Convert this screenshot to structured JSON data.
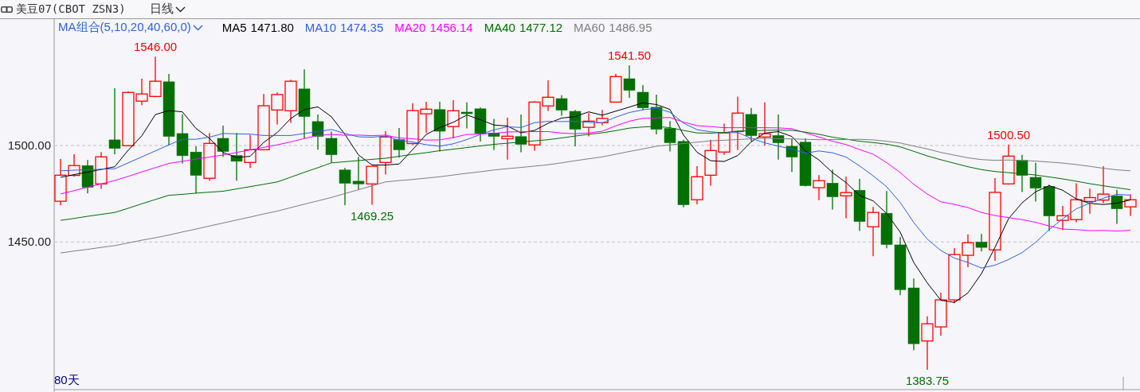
{
  "header": {
    "title": "美豆07(CBOT ZSN3)",
    "period": "日线"
  },
  "chart": {
    "indicator": "MA组合(5,10,20,40,60,0)",
    "legend": [
      {
        "reading": "1471.80"
      },
      {
        "reading": "1474.35"
      },
      {
        "reading": "1456.14"
      },
      {
        "reading": "1477.12"
      },
      {
        "reading": "1486.95"
      }
    ],
    "span_label": "80天",
    "candles": {
      "chart_data": {
        "type": "candlestick",
        "ohlc": [
          [
            1471.1,
            1493.0,
            1469.1,
            1484.6
          ],
          [
            1484.5,
            1495.5,
            1483.8,
            1489.6
          ],
          [
            1489.6,
            1492.5,
            1475.2,
            1478.3
          ],
          [
            1480.1,
            1496.6,
            1477.5,
            1494.1
          ],
          [
            1502.9,
            1529.7,
            1495.5,
            1498.5
          ],
          [
            1499.9,
            1528.0,
            1499.6,
            1527.5
          ],
          [
            1523.0,
            1534.6,
            1520.9,
            1526.7
          ],
          [
            1525.4,
            1546.0,
            1525.0,
            1533.3
          ],
          [
            1533.0,
            1537.1,
            1500.0,
            1504.7
          ],
          [
            1506.2,
            1516.1,
            1490.7,
            1494.7
          ],
          [
            1496.6,
            1499.6,
            1475.2,
            1484.5
          ],
          [
            1483.0,
            1506.5,
            1481.8,
            1501.1
          ],
          [
            1503.7,
            1510.3,
            1494.1,
            1496.9
          ],
          [
            1494.8,
            1506.5,
            1481.8,
            1491.8
          ],
          [
            1491.2,
            1505.4,
            1488.4,
            1497.8
          ],
          [
            1497.8,
            1526.7,
            1497.8,
            1520.6
          ],
          [
            1518.4,
            1527.5,
            1510.9,
            1526.4
          ],
          [
            1518.0,
            1534.1,
            1511.7,
            1533.3
          ],
          [
            1529.3,
            1539.4,
            1503.7,
            1515.0
          ],
          [
            1512.4,
            1516.1,
            1497.8,
            1504.7
          ],
          [
            1503.7,
            1507.2,
            1491.0,
            1495.2
          ],
          [
            1487.3,
            1488.4,
            1469.1,
            1480.4
          ],
          [
            1481.5,
            1494.1,
            1477.0,
            1480.1
          ],
          [
            1480.1,
            1489.2,
            1469.25,
            1489.2
          ],
          [
            1491.2,
            1507.4,
            1484.9,
            1504.4
          ],
          [
            1503.0,
            1509.1,
            1493.7,
            1497.8
          ],
          [
            1501.0,
            1521.9,
            1500.3,
            1518.1
          ],
          [
            1516.4,
            1522.7,
            1506.5,
            1518.8
          ],
          [
            1518.6,
            1522.7,
            1496.9,
            1507.4
          ],
          [
            1509.8,
            1523.5,
            1503.7,
            1518.0
          ],
          [
            1517.3,
            1522.3,
            1508.8,
            1516.8
          ],
          [
            1519.0,
            1519.8,
            1502.1,
            1506.2
          ],
          [
            1506.5,
            1513.8,
            1497.6,
            1504.7
          ],
          [
            1503.5,
            1514.4,
            1492.7,
            1504.8
          ],
          [
            1504.6,
            1516.1,
            1496.5,
            1500.6
          ],
          [
            1500.3,
            1523.0,
            1497.3,
            1522.5
          ],
          [
            1520.5,
            1533.8,
            1517.9,
            1525.0
          ],
          [
            1524.3,
            1526.0,
            1515.4,
            1518.3
          ],
          [
            1517.7,
            1518.4,
            1499.6,
            1508.4
          ],
          [
            1509.4,
            1516.8,
            1504.7,
            1512.6
          ],
          [
            1511.8,
            1518.4,
            1510.5,
            1514.0
          ],
          [
            1522.5,
            1537.1,
            1522.5,
            1535.7
          ],
          [
            1534.6,
            1541.5,
            1524.7,
            1528.6
          ],
          [
            1527.6,
            1531.3,
            1518.4,
            1519.5
          ],
          [
            1519.8,
            1526.4,
            1505.8,
            1508.4
          ],
          [
            1508.8,
            1512.7,
            1496.9,
            1501.4
          ],
          [
            1502.1,
            1503.0,
            1468.0,
            1469.3
          ],
          [
            1471.9,
            1489.3,
            1469.5,
            1483.8
          ],
          [
            1484.6,
            1503.0,
            1479.2,
            1497.4
          ],
          [
            1496.6,
            1511.3,
            1495.1,
            1506.5
          ],
          [
            1507.2,
            1525.3,
            1497.6,
            1516.8
          ],
          [
            1516.1,
            1519.5,
            1502.1,
            1505.1
          ],
          [
            1504.4,
            1522.3,
            1500.0,
            1506.1
          ],
          [
            1505.2,
            1516.1,
            1492.7,
            1501.4
          ],
          [
            1499.6,
            1503.7,
            1486.3,
            1494.0
          ],
          [
            1501.7,
            1503.7,
            1478.8,
            1479.2
          ],
          [
            1478.1,
            1484.6,
            1471.7,
            1481.8
          ],
          [
            1480.5,
            1487.5,
            1466.8,
            1473.4
          ],
          [
            1473.9,
            1483.8,
            1462.3,
            1475.6
          ],
          [
            1476.8,
            1482.7,
            1455.7,
            1460.6
          ],
          [
            1457.9,
            1468.2,
            1442.6,
            1465.3
          ],
          [
            1464.9,
            1476.4,
            1446.7,
            1448.7
          ],
          [
            1448.5,
            1452.5,
            1422.4,
            1425.3
          ],
          [
            1426.2,
            1431.1,
            1393.9,
            1397.3
          ],
          [
            1398.7,
            1411.5,
            1383.75,
            1407.6
          ],
          [
            1406.0,
            1423.7,
            1401.4,
            1420.0
          ],
          [
            1420.0,
            1446.8,
            1418.3,
            1443.5
          ],
          [
            1443.1,
            1453.9,
            1436.9,
            1449.6
          ],
          [
            1450.0,
            1454.2,
            1445.1,
            1447.2
          ],
          [
            1445.9,
            1483.1,
            1440.2,
            1475.7
          ],
          [
            1480.1,
            1500.5,
            1479.7,
            1494.5
          ],
          [
            1492.3,
            1495.1,
            1475.9,
            1484.5
          ],
          [
            1483.5,
            1491.0,
            1470.9,
            1477.9
          ],
          [
            1478.7,
            1479.7,
            1455.7,
            1463.5
          ],
          [
            1461.2,
            1468.7,
            1456.1,
            1463.6
          ],
          [
            1461.6,
            1480.4,
            1460.2,
            1471.9
          ],
          [
            1471.0,
            1477.6,
            1464.7,
            1473.0
          ],
          [
            1471.7,
            1489.3,
            1470.1,
            1474.8
          ],
          [
            1473.9,
            1477.0,
            1459.4,
            1467.2
          ],
          [
            1468.2,
            1474.6,
            1463.5,
            1471.9
          ]
        ],
        "ylim": [
          1373.5,
          1565.5
        ],
        "yticks": [
          {
            "value": 1500,
            "label": "1500.00"
          },
          {
            "value": 1450,
            "label": "1450.00"
          }
        ],
        "annotations": [
          "1546.00",
          "1541.50",
          "1500.50",
          "1469.25",
          "1383.75"
        ]
      }
    },
    "averages": {
      "chart_data": {
        "type": "line",
        "series": [
          {
            "name": "MA5",
            "color": "#000000",
            "values": [
              1483.5,
              1484.9,
              1486.2,
              1487.6,
              1489.0,
              1497.6,
              1505.0,
              1516.0,
              1518.1,
              1517.4,
              1508.8,
              1503.7,
              1496.4,
              1493.8,
              1494.4,
              1501.6,
              1506.7,
              1514.0,
              1518.6,
              1520.0,
              1514.9,
              1505.7,
              1495.1,
              1489.9,
              1489.9,
              1490.4,
              1497.9,
              1505.7,
              1509.3,
              1512.0,
              1515.8,
              1513.4,
              1510.6,
              1510.1,
              1506.6,
              1507.8,
              1511.5,
              1514.2,
              1515.0,
              1517.4,
              1515.7,
              1517.8,
              1519.9,
              1522.1,
              1521.2,
              1518.7,
              1505.4,
              1496.5,
              1492.1,
              1491.7,
              1494.8,
              1501.9,
              1506.4,
              1507.2,
              1504.7,
              1497.2,
              1492.5,
              1486.0,
              1480.8,
              1474.1,
              1471.3,
              1464.7,
              1455.1,
              1439.4,
              1428.8,
              1419.8,
              1418.7,
              1423.6,
              1433.6,
              1447.2,
              1462.1,
              1470.3,
              1476.0,
              1479.2,
              1476.8,
              1472.3,
              1470.0,
              1469.4,
              1470.1,
              1471.8
            ]
          },
          {
            "name": "MA10",
            "color": "#2f62e6",
            "values": [
              1486.9,
              1487.2,
              1487.4,
              1487.7,
              1487.9,
              1491.0,
              1494.1,
              1497.2,
              1500.3,
              1503.2,
              1503.2,
              1504.3,
              1506.2,
              1506.0,
              1505.9,
              1505.2,
              1505.2,
              1505.2,
              1506.2,
              1507.2,
              1508.3,
              1506.2,
              1504.5,
              1504.3,
              1504.9,
              1502.7,
              1501.8,
              1500.4,
              1499.6,
              1500.9,
              1503.1,
              1505.7,
              1508.1,
              1509.7,
              1509.3,
              1511.8,
              1512.5,
              1512.4,
              1512.5,
              1512.0,
              1511.7,
              1514.7,
              1517.1,
              1518.5,
              1519.3,
              1517.2,
              1511.6,
              1508.2,
              1507.1,
              1506.5,
              1506.7,
              1503.7,
              1501.4,
              1499.6,
              1498.2,
              1496.0,
              1497.2,
              1496.2,
              1494.0,
              1489.4,
              1484.3,
              1478.6,
              1470.5,
              1460.1,
              1451.5,
              1445.6,
              1441.7,
              1439.4,
              1436.5,
              1438.0,
              1440.9,
              1444.5,
              1449.8,
              1456.4,
              1462.0,
              1467.2,
              1470.1,
              1472.7,
              1474.7,
              1474.3
            ]
          },
          {
            "name": "MA20",
            "color": "#ff00ff",
            "values": [
              1474.9,
              1476.6,
              1478.4,
              1480.1,
              1481.8,
              1484.0,
              1486.3,
              1488.5,
              1490.7,
              1491.8,
              1492.9,
              1494.0,
              1495.1,
              1496.4,
              1497.7,
              1499.0,
              1500.3,
              1501.9,
              1503.6,
              1505.2,
              1505.7,
              1505.3,
              1505.4,
              1505.1,
              1505.4,
              1503.9,
              1503.5,
              1502.8,
              1502.9,
              1504.1,
              1505.7,
              1505.9,
              1506.3,
              1507.0,
              1507.1,
              1507.2,
              1507.2,
              1506.4,
              1506.1,
              1506.5,
              1507.4,
              1510.2,
              1512.6,
              1514.1,
              1514.3,
              1514.5,
              1512.1,
              1510.3,
              1509.8,
              1509.2,
              1509.2,
              1509.2,
              1509.2,
              1509.1,
              1508.7,
              1506.6,
              1504.4,
              1502.2,
              1500.5,
              1497.9,
              1495.5,
              1491.1,
              1486.0,
              1479.9,
              1474.8,
              1470.8,
              1469.5,
              1467.8,
              1465.3,
              1463.7,
              1462.6,
              1461.6,
              1460.2,
              1458.3,
              1456.7,
              1456.4,
              1455.9,
              1456.0,
              1455.6,
              1456.1
            ]
          },
          {
            "name": "MA40",
            "color": "#007000",
            "values": [
              1461.2,
              1462.2,
              1463.3,
              1464.3,
              1465.3,
              1467.5,
              1469.8,
              1472.0,
              1474.2,
              1474.7,
              1475.3,
              1475.8,
              1476.3,
              1477.5,
              1478.7,
              1479.9,
              1481.1,
              1483.6,
              1486.1,
              1488.5,
              1491.0,
              1491.6,
              1492.2,
              1492.8,
              1493.4,
              1494.4,
              1495.4,
              1496.3,
              1497.3,
              1498.1,
              1498.9,
              1499.8,
              1500.6,
              1501.2,
              1501.8,
              1502.4,
              1503.0,
              1503.9,
              1504.9,
              1505.8,
              1506.6,
              1507.7,
              1509.0,
              1509.6,
              1509.9,
              1509.2,
              1507.8,
              1506.5,
              1506.4,
              1506.7,
              1507.5,
              1507.6,
              1507.8,
              1508.0,
              1507.9,
              1506.9,
              1505.8,
              1504.3,
              1503.3,
              1502.2,
              1501.5,
              1500.7,
              1499.3,
              1497.0,
              1494.6,
              1492.6,
              1490.8,
              1489.0,
              1487.5,
              1486.5,
              1485.9,
              1485.4,
              1484.7,
              1483.7,
              1482.7,
              1481.5,
              1480.2,
              1479.1,
              1478.1,
              1477.1
            ]
          },
          {
            "name": "MA60",
            "color": "#808080",
            "values": [
              1444.3,
              1445.3,
              1446.2,
              1447.2,
              1448.1,
              1449.5,
              1450.9,
              1452.2,
              1453.6,
              1455.2,
              1456.7,
              1458.3,
              1459.8,
              1461.4,
              1462.9,
              1464.5,
              1466.0,
              1467.8,
              1469.6,
              1471.3,
              1473.1,
              1475.1,
              1477.1,
              1479.1,
              1481.1,
              1481.8,
              1482.4,
              1483.1,
              1483.8,
              1484.7,
              1485.6,
              1486.4,
              1487.3,
              1488.0,
              1488.6,
              1489.3,
              1490.0,
              1491.0,
              1492.1,
              1493.1,
              1494.1,
              1495.5,
              1496.9,
              1498.2,
              1499.6,
              1500.3,
              1501.0,
              1501.7,
              1502.4,
              1502.7,
              1503.1,
              1503.4,
              1503.7,
              1503.5,
              1503.4,
              1503.2,
              1503.0,
              1503.1,
              1503.1,
              1503.2,
              1502.9,
              1502.2,
              1501.3,
              1499.7,
              1498.2,
              1496.4,
              1495.0,
              1493.6,
              1492.7,
              1492.3,
              1492.5,
              1492.2,
              1491.9,
              1491.4,
              1490.9,
              1490.1,
              1489.2,
              1488.2,
              1487.4,
              1486.9
            ]
          }
        ],
        "ylim": [
          1373.5,
          1565.5
        ]
      }
    }
  }
}
